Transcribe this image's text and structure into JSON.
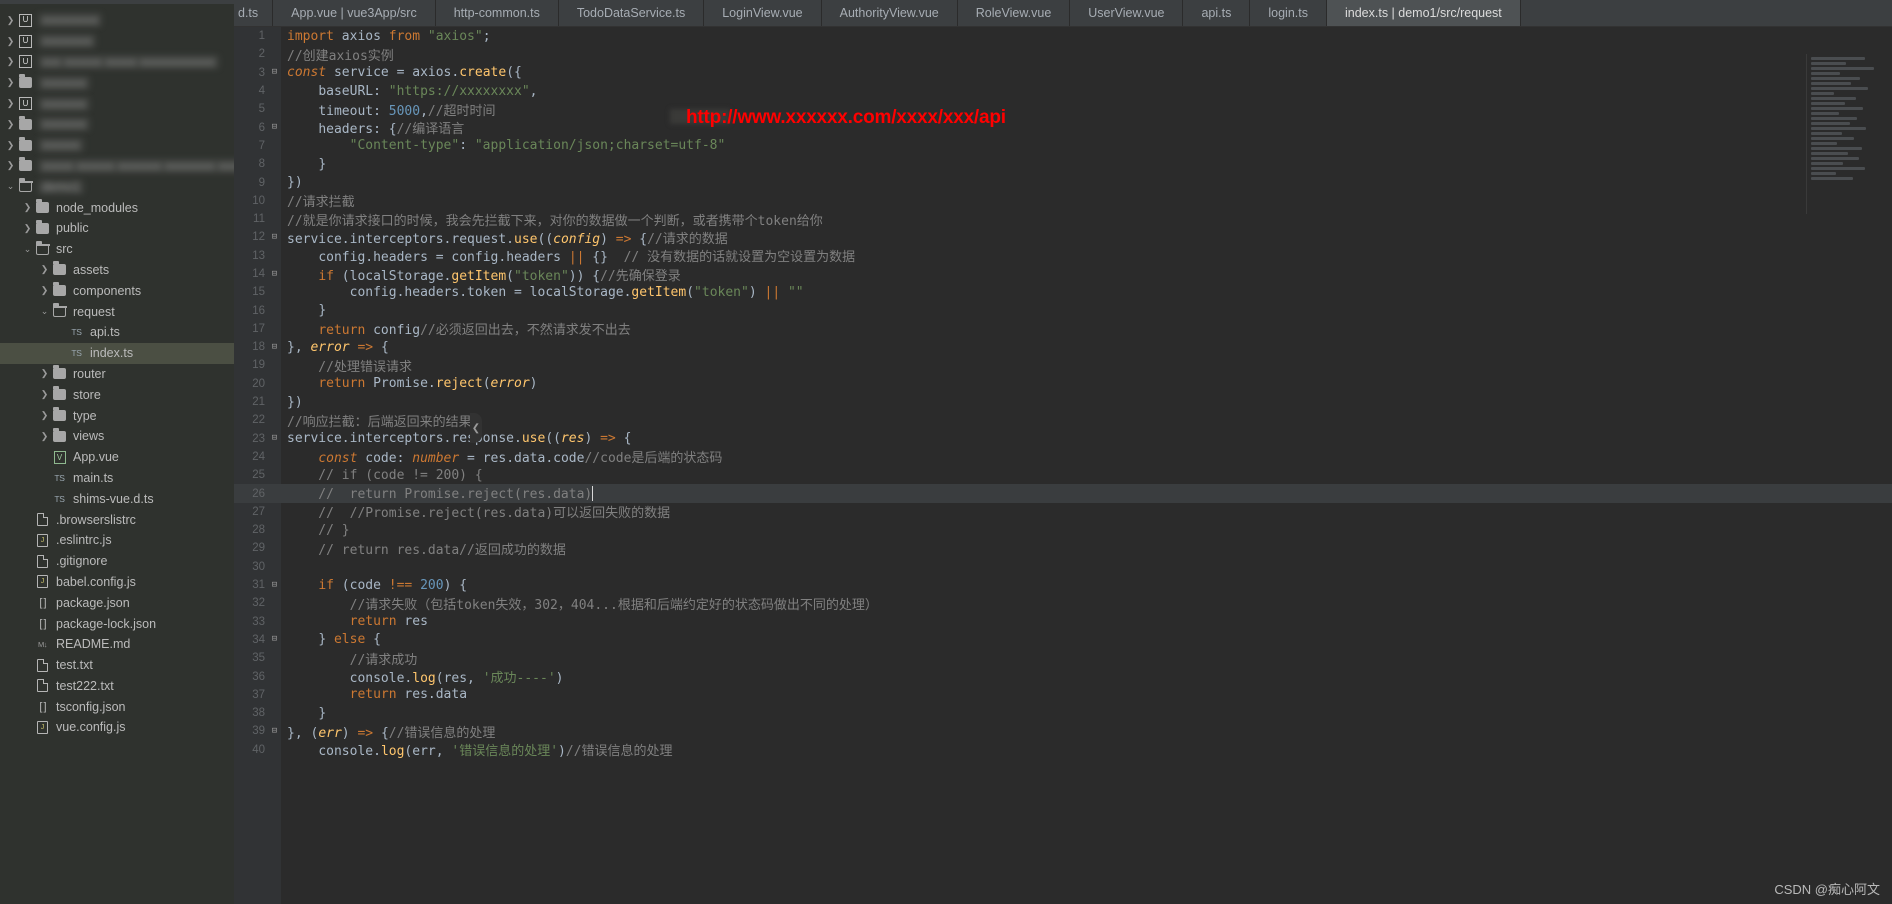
{
  "window": {
    "watermark": "CSDN @痴心阿文"
  },
  "tabs": [
    {
      "label": "d.ts",
      "active": false,
      "partial": true
    },
    {
      "label": "App.vue | vue3App/src",
      "active": false
    },
    {
      "label": "http-common.ts",
      "active": false
    },
    {
      "label": "TodoDataService.ts",
      "active": false
    },
    {
      "label": "LoginView.vue",
      "active": false
    },
    {
      "label": "AuthorityView.vue",
      "active": false
    },
    {
      "label": "RoleView.vue",
      "active": false
    },
    {
      "label": "UserView.vue",
      "active": false
    },
    {
      "label": "api.ts",
      "active": false
    },
    {
      "label": "login.ts",
      "active": false
    },
    {
      "label": "index.ts | demo1/src/request",
      "active": true
    }
  ],
  "sidebar": {
    "items": [
      {
        "label": "xxxxxxxxx",
        "indent": 0,
        "arrow": "right",
        "icon": "module-icon",
        "blurred": true
      },
      {
        "label": "xxxxxxxx",
        "indent": 0,
        "arrow": "right",
        "icon": "module-icon",
        "blurred": true
      },
      {
        "label": "xxx xxxxxx xxxxx xxxxxxxxxxxx",
        "indent": 0,
        "arrow": "right",
        "icon": "module-icon",
        "blurred": true
      },
      {
        "label": "xxxxxxx",
        "indent": 0,
        "arrow": "right",
        "icon": "folder-icon",
        "blurred": true
      },
      {
        "label": "xxxxxxx",
        "indent": 0,
        "arrow": "right",
        "icon": "module-icon",
        "blurred": true
      },
      {
        "label": "xxxxxxx",
        "indent": 0,
        "arrow": "right",
        "icon": "folder-icon",
        "blurred": true
      },
      {
        "label": "xxxxxx",
        "indent": 0,
        "arrow": "right",
        "icon": "folder-icon",
        "blurred": true
      },
      {
        "label": "xxxxx xxxxxx xxxxxxx xxxxxxxx xxxxx",
        "indent": 0,
        "arrow": "right",
        "icon": "folder-icon",
        "blurred": true
      },
      {
        "label": "demo1",
        "indent": 0,
        "arrow": "down",
        "icon": "folder-open-icon",
        "blurred": true
      },
      {
        "label": "node_modules",
        "indent": 1,
        "arrow": "right",
        "icon": "folder-icon",
        "blurred": false
      },
      {
        "label": "public",
        "indent": 1,
        "arrow": "right",
        "icon": "folder-icon",
        "blurred": false
      },
      {
        "label": "src",
        "indent": 1,
        "arrow": "down",
        "icon": "folder-open-icon",
        "blurred": false
      },
      {
        "label": "assets",
        "indent": 2,
        "arrow": "right",
        "icon": "folder-icon",
        "blurred": false
      },
      {
        "label": "components",
        "indent": 2,
        "arrow": "right",
        "icon": "folder-icon",
        "blurred": false
      },
      {
        "label": "request",
        "indent": 2,
        "arrow": "down",
        "icon": "folder-open-icon",
        "blurred": false
      },
      {
        "label": "api.ts",
        "indent": 3,
        "arrow": "none",
        "icon": "ts-icon",
        "blurred": false
      },
      {
        "label": "index.ts",
        "indent": 3,
        "arrow": "none",
        "icon": "ts-icon",
        "blurred": false,
        "selected": true
      },
      {
        "label": "router",
        "indent": 2,
        "arrow": "right",
        "icon": "folder-icon",
        "blurred": false
      },
      {
        "label": "store",
        "indent": 2,
        "arrow": "right",
        "icon": "folder-icon",
        "blurred": false
      },
      {
        "label": "type",
        "indent": 2,
        "arrow": "right",
        "icon": "folder-icon",
        "blurred": false
      },
      {
        "label": "views",
        "indent": 2,
        "arrow": "right",
        "icon": "folder-icon",
        "blurred": false
      },
      {
        "label": "App.vue",
        "indent": 2,
        "arrow": "none",
        "icon": "vue-icon",
        "blurred": false
      },
      {
        "label": "main.ts",
        "indent": 2,
        "arrow": "none",
        "icon": "ts-icon",
        "blurred": false
      },
      {
        "label": "shims-vue.d.ts",
        "indent": 2,
        "arrow": "none",
        "icon": "ts-icon",
        "blurred": false
      },
      {
        "label": ".browserslistrc",
        "indent": 1,
        "arrow": "none",
        "icon": "file-icon",
        "blurred": false
      },
      {
        "label": ".eslintrc.js",
        "indent": 1,
        "arrow": "none",
        "icon": "js-icon",
        "blurred": false
      },
      {
        "label": ".gitignore",
        "indent": 1,
        "arrow": "none",
        "icon": "file-icon",
        "blurred": false
      },
      {
        "label": "babel.config.js",
        "indent": 1,
        "arrow": "none",
        "icon": "js-icon",
        "blurred": false
      },
      {
        "label": "package.json",
        "indent": 1,
        "arrow": "none",
        "icon": "json-icon",
        "blurred": false
      },
      {
        "label": "package-lock.json",
        "indent": 1,
        "arrow": "none",
        "icon": "json-icon",
        "blurred": false
      },
      {
        "label": "README.md",
        "indent": 1,
        "arrow": "none",
        "icon": "md-icon",
        "blurred": false
      },
      {
        "label": "test.txt",
        "indent": 1,
        "arrow": "none",
        "icon": "file-icon",
        "blurred": false
      },
      {
        "label": "test222.txt",
        "indent": 1,
        "arrow": "none",
        "icon": "file-icon",
        "blurred": false
      },
      {
        "label": "tsconfig.json",
        "indent": 1,
        "arrow": "none",
        "icon": "json-icon",
        "blurred": false
      },
      {
        "label": "vue.config.js",
        "indent": 1,
        "arrow": "none",
        "icon": "js-icon",
        "blurred": false
      }
    ]
  },
  "annotation": {
    "red_url_text": "http://www.xxxxxx.com/xxxx/xxx/api"
  },
  "editor": {
    "lines": [
      {
        "n": 1,
        "fold": "",
        "text": "import axios from \"axios\";"
      },
      {
        "n": 2,
        "fold": "",
        "text": "//创建axios实例"
      },
      {
        "n": 3,
        "fold": "-",
        "text": "const service = axios.create({"
      },
      {
        "n": 4,
        "fold": "",
        "text": "    baseURL: \"https://xxxxxxxx\","
      },
      {
        "n": 5,
        "fold": "",
        "text": "    timeout: 5000,//超时时间"
      },
      {
        "n": 6,
        "fold": "-",
        "text": "    headers: {//编译语言"
      },
      {
        "n": 7,
        "fold": "",
        "text": "        \"Content-type\": \"application/json;charset=utf-8\""
      },
      {
        "n": 8,
        "fold": "",
        "text": "    }"
      },
      {
        "n": 9,
        "fold": "",
        "text": "})"
      },
      {
        "n": 10,
        "fold": "",
        "text": "//请求拦截"
      },
      {
        "n": 11,
        "fold": "",
        "text": "//就是你请求接口的时候，我会先拦截下来，对你的数据做一个判断，或者携带个token给你"
      },
      {
        "n": 12,
        "fold": "-",
        "text": "service.interceptors.request.use((config) => {//请求的数据"
      },
      {
        "n": 13,
        "fold": "",
        "text": "    config.headers = config.headers || {}  // 没有数据的话就设置为空设置为数据"
      },
      {
        "n": 14,
        "fold": "-",
        "text": "    if (localStorage.getItem(\"token\")) {//先确保登录"
      },
      {
        "n": 15,
        "fold": "",
        "text": "        config.headers.token = localStorage.getItem(\"token\") || \"\""
      },
      {
        "n": 16,
        "fold": "",
        "text": "    }"
      },
      {
        "n": 17,
        "fold": "",
        "text": "    return config//必须返回出去，不然请求发不出去"
      },
      {
        "n": 18,
        "fold": "-",
        "text": "}, error => {"
      },
      {
        "n": 19,
        "fold": "",
        "text": "    //处理错误请求"
      },
      {
        "n": 20,
        "fold": "",
        "text": "    return Promise.reject(error)"
      },
      {
        "n": 21,
        "fold": "",
        "text": "})"
      },
      {
        "n": 22,
        "fold": "",
        "text": "//响应拦截：后端返回来的结果"
      },
      {
        "n": 23,
        "fold": "-",
        "text": "service.interceptors.response.use((res) => {"
      },
      {
        "n": 24,
        "fold": "",
        "text": "    const code: number = res.data.code//code是后端的状态码"
      },
      {
        "n": 25,
        "fold": "",
        "text": "    // if (code != 200) {"
      },
      {
        "n": 26,
        "fold": "",
        "text": "    //  return Promise.reject(res.data)",
        "highlight": true
      },
      {
        "n": 27,
        "fold": "",
        "text": "    //  //Promise.reject(res.data)可以返回失败的数据"
      },
      {
        "n": 28,
        "fold": "",
        "text": "    // }"
      },
      {
        "n": 29,
        "fold": "",
        "text": "    // return res.data//返回成功的数据"
      },
      {
        "n": 30,
        "fold": "",
        "text": ""
      },
      {
        "n": 31,
        "fold": "-",
        "text": "    if (code !== 200) {"
      },
      {
        "n": 32,
        "fold": "",
        "text": "        //请求失败（包括token失效，302，404...根据和后端约定好的状态码做出不同的处理）"
      },
      {
        "n": 33,
        "fold": "",
        "text": "        return res"
      },
      {
        "n": 34,
        "fold": "-",
        "text": "    } else {"
      },
      {
        "n": 35,
        "fold": "",
        "text": "        //请求成功"
      },
      {
        "n": 36,
        "fold": "",
        "text": "        console.log(res, '成功----')"
      },
      {
        "n": 37,
        "fold": "",
        "text": "        return res.data"
      },
      {
        "n": 38,
        "fold": "",
        "text": "    }"
      },
      {
        "n": 39,
        "fold": "-",
        "text": "}, (err) => {//错误信息的处理"
      },
      {
        "n": 40,
        "fold": "",
        "text": "    console.log(err, '错误信息的处理')//错误信息的处理"
      }
    ]
  },
  "colors": {
    "editor_bg": "#2b2b2b",
    "sidebar_bg": "#2f322e",
    "tabbar_bg": "#3c3f41",
    "active_tab_bg": "#4e5254",
    "selection_bg": "#4b4f43",
    "annotation_red": "#ff0000",
    "keyword": "#cc7832",
    "string": "#6a8759",
    "number": "#6897bb",
    "comment": "#808080",
    "plain": "#a9b7c6"
  }
}
